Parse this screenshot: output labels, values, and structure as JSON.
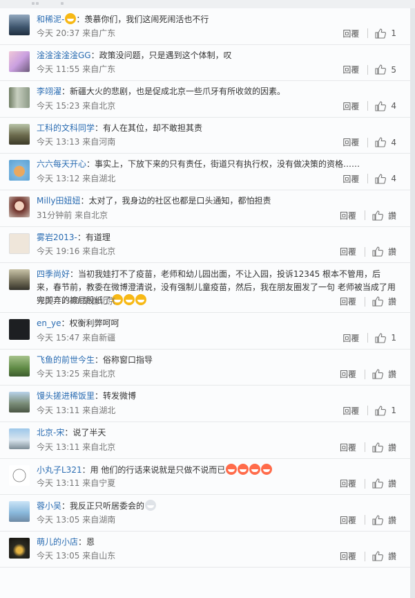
{
  "colors": {
    "username": "#2a6cb2",
    "text": "#333333",
    "meta": "#777777",
    "divider": "#e6e8ea"
  },
  "labels": {
    "reply": "回覆",
    "reply_simplified": "回覆",
    "like_zero": "讚",
    "separator": "：",
    "from": "来自"
  },
  "comments": [
    {
      "user": "和稀泥-",
      "emoji_before": "love-face-emoji",
      "text": "羡慕你们，我们这闹死闹活也不行",
      "emoji_after": [],
      "time": "今天 20:37",
      "location": "来自广东",
      "reply": "回覆",
      "like": "1"
    },
    {
      "user": "淦淦淦淦淦GG",
      "text": "政策没问题，只是遇到这个体制，叹",
      "emoji_after": [],
      "time": "今天 11:55",
      "location": "来自广东",
      "reply": "回覆",
      "like": "5"
    },
    {
      "user": "李翊濯",
      "text": "新疆大火的悲剧，也是促成北京一些爪牙有所收敛的因素。",
      "emoji_after": [],
      "time": "今天 15:23",
      "location": "来自北京",
      "reply": "回覆",
      "like": "4"
    },
    {
      "user": "工科的文科同学",
      "text": "有人在其位，却不敢担其责",
      "emoji_after": [],
      "time": "今天 13:13",
      "location": "来自河南",
      "reply": "回覆",
      "like": "4"
    },
    {
      "user": "六六每天开心",
      "text": "事实上，下放下来的只有责任，街道只有执行权，没有做决策的资格……",
      "emoji_after": [],
      "time": "今天 13:12",
      "location": "来自湖北",
      "reply": "回覆",
      "like": "4"
    },
    {
      "user": "Milly田妞妞",
      "text": "太对了，我身边的社区也都是口头通知，都怕担责",
      "emoji_after": [],
      "time": "31分钟前",
      "location": "来自北京",
      "reply": "回覆",
      "like": "讚"
    },
    {
      "user": "雾岩2013-",
      "text": "有道理",
      "emoji_after": [],
      "time": "今天 19:16",
      "location": "来自北京",
      "reply": "回覆",
      "like": "讚"
    },
    {
      "user": "四季尚好",
      "text": "当初我娃打不了疫苗，老师和幼儿园出面，不让入园，投诉12345 根本不管用，后来，春节前，教委在微博澄清说，没有强制儿童疫苗，然后，我在朋友圈发了一句 老师被当成了用完即弃的擦屁股纸了",
      "emoji_after": [
        "grin-emoji",
        "grin-emoji",
        "grin-emoji"
      ],
      "time": "今天 17:40",
      "location": "来自北京",
      "reply": "回覆",
      "like": "讚"
    },
    {
      "user": "en_ye",
      "text": "权衡利弊呵呵",
      "emoji_after": [],
      "time": "今天 15:47",
      "location": "来自新疆",
      "reply": "回覆",
      "like": "1"
    },
    {
      "user": "飞鱼的前世今生",
      "text": "俗称窗口指导",
      "emoji_after": [],
      "time": "今天 13:25",
      "location": "来自北京",
      "reply": "回覆",
      "like": "讚"
    },
    {
      "user": "馒头搓进稀饭里",
      "text": "转发微博",
      "emoji_after": [],
      "time": "今天 13:11",
      "location": "来自湖北",
      "reply": "回覆",
      "like": "1"
    },
    {
      "user": "北京-宋",
      "text": "说了半天",
      "emoji_after": [],
      "time": "今天 13:11",
      "location": "来自北京",
      "reply": "回覆",
      "like": "讚"
    },
    {
      "user": "小丸子L321",
      "text": "用 他们的行话来说就是只做不说而已",
      "emoji_after": [
        "laugh-emoji",
        "laugh-emoji",
        "laugh-emoji",
        "laugh-emoji"
      ],
      "time": "今天 13:11",
      "location": "来自宁夏",
      "reply": "回覆",
      "like": "讚"
    },
    {
      "user": "蓉小吴",
      "text": "我反正只听居委会的",
      "emoji_after": [
        "panda-emoji"
      ],
      "time": "今天 13:05",
      "location": "来自湖南",
      "reply": "回覆",
      "like": "讚"
    },
    {
      "user": "萌儿的小店",
      "text": "恩",
      "emoji_after": [],
      "time": "今天 13:05",
      "location": "来自山东",
      "reply": "回覆",
      "like": "讚"
    }
  ]
}
